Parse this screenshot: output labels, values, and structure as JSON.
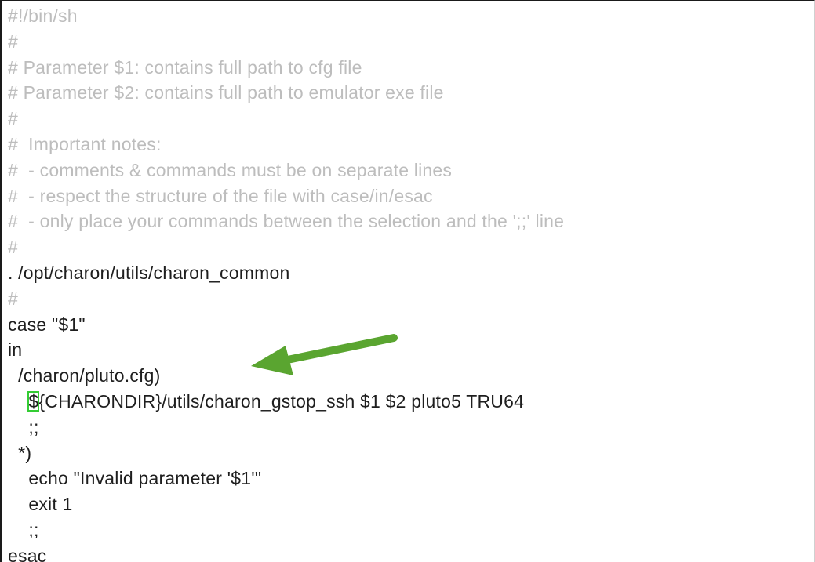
{
  "editor": {
    "lines": [
      {
        "text": "#!/bin/sh",
        "type": "comment"
      },
      {
        "text": "#",
        "type": "comment"
      },
      {
        "text": "# Parameter $1: contains full path to cfg file",
        "type": "comment"
      },
      {
        "text": "# Parameter $2: contains full path to emulator exe file",
        "type": "comment"
      },
      {
        "text": "#",
        "type": "comment"
      },
      {
        "text": "#  Important notes:",
        "type": "comment"
      },
      {
        "text": "#  - comments & commands must be on separate lines",
        "type": "comment"
      },
      {
        "text": "#  - respect the structure of the file with case/in/esac",
        "type": "comment"
      },
      {
        "text": "#  - only place your commands between the selection and the ';;' line",
        "type": "comment"
      },
      {
        "text": "#",
        "type": "comment"
      },
      {
        "text": ". /opt/charon/utils/charon_common",
        "type": "code"
      },
      {
        "text": "#",
        "type": "comment"
      },
      {
        "text": "case \"$1\"",
        "type": "code"
      },
      {
        "text": "in",
        "type": "code"
      },
      {
        "text": "  /charon/pluto.cfg)",
        "type": "code"
      },
      {
        "cursor_prefix": "    ",
        "cursor_char": "$",
        "rest": "{CHARONDIR}/utils/charon_gstop_ssh $1 $2 pluto5 TRU64",
        "type": "code"
      },
      {
        "text": "    ;;",
        "type": "code"
      },
      {
        "text": "  *)",
        "type": "code"
      },
      {
        "text": "    echo \"Invalid parameter '$1'\"",
        "type": "code"
      },
      {
        "text": "    exit 1",
        "type": "code"
      },
      {
        "text": "    ;;",
        "type": "code"
      },
      {
        "text": "esac",
        "type": "code"
      }
    ]
  },
  "colors": {
    "comment": "#bdbdbd",
    "code": "#1e1e1e",
    "cursor_outline": "#33cc33",
    "arrow": "#5aa530"
  },
  "annotations": {
    "arrow_icon": "green-arrow-pointing-left"
  }
}
